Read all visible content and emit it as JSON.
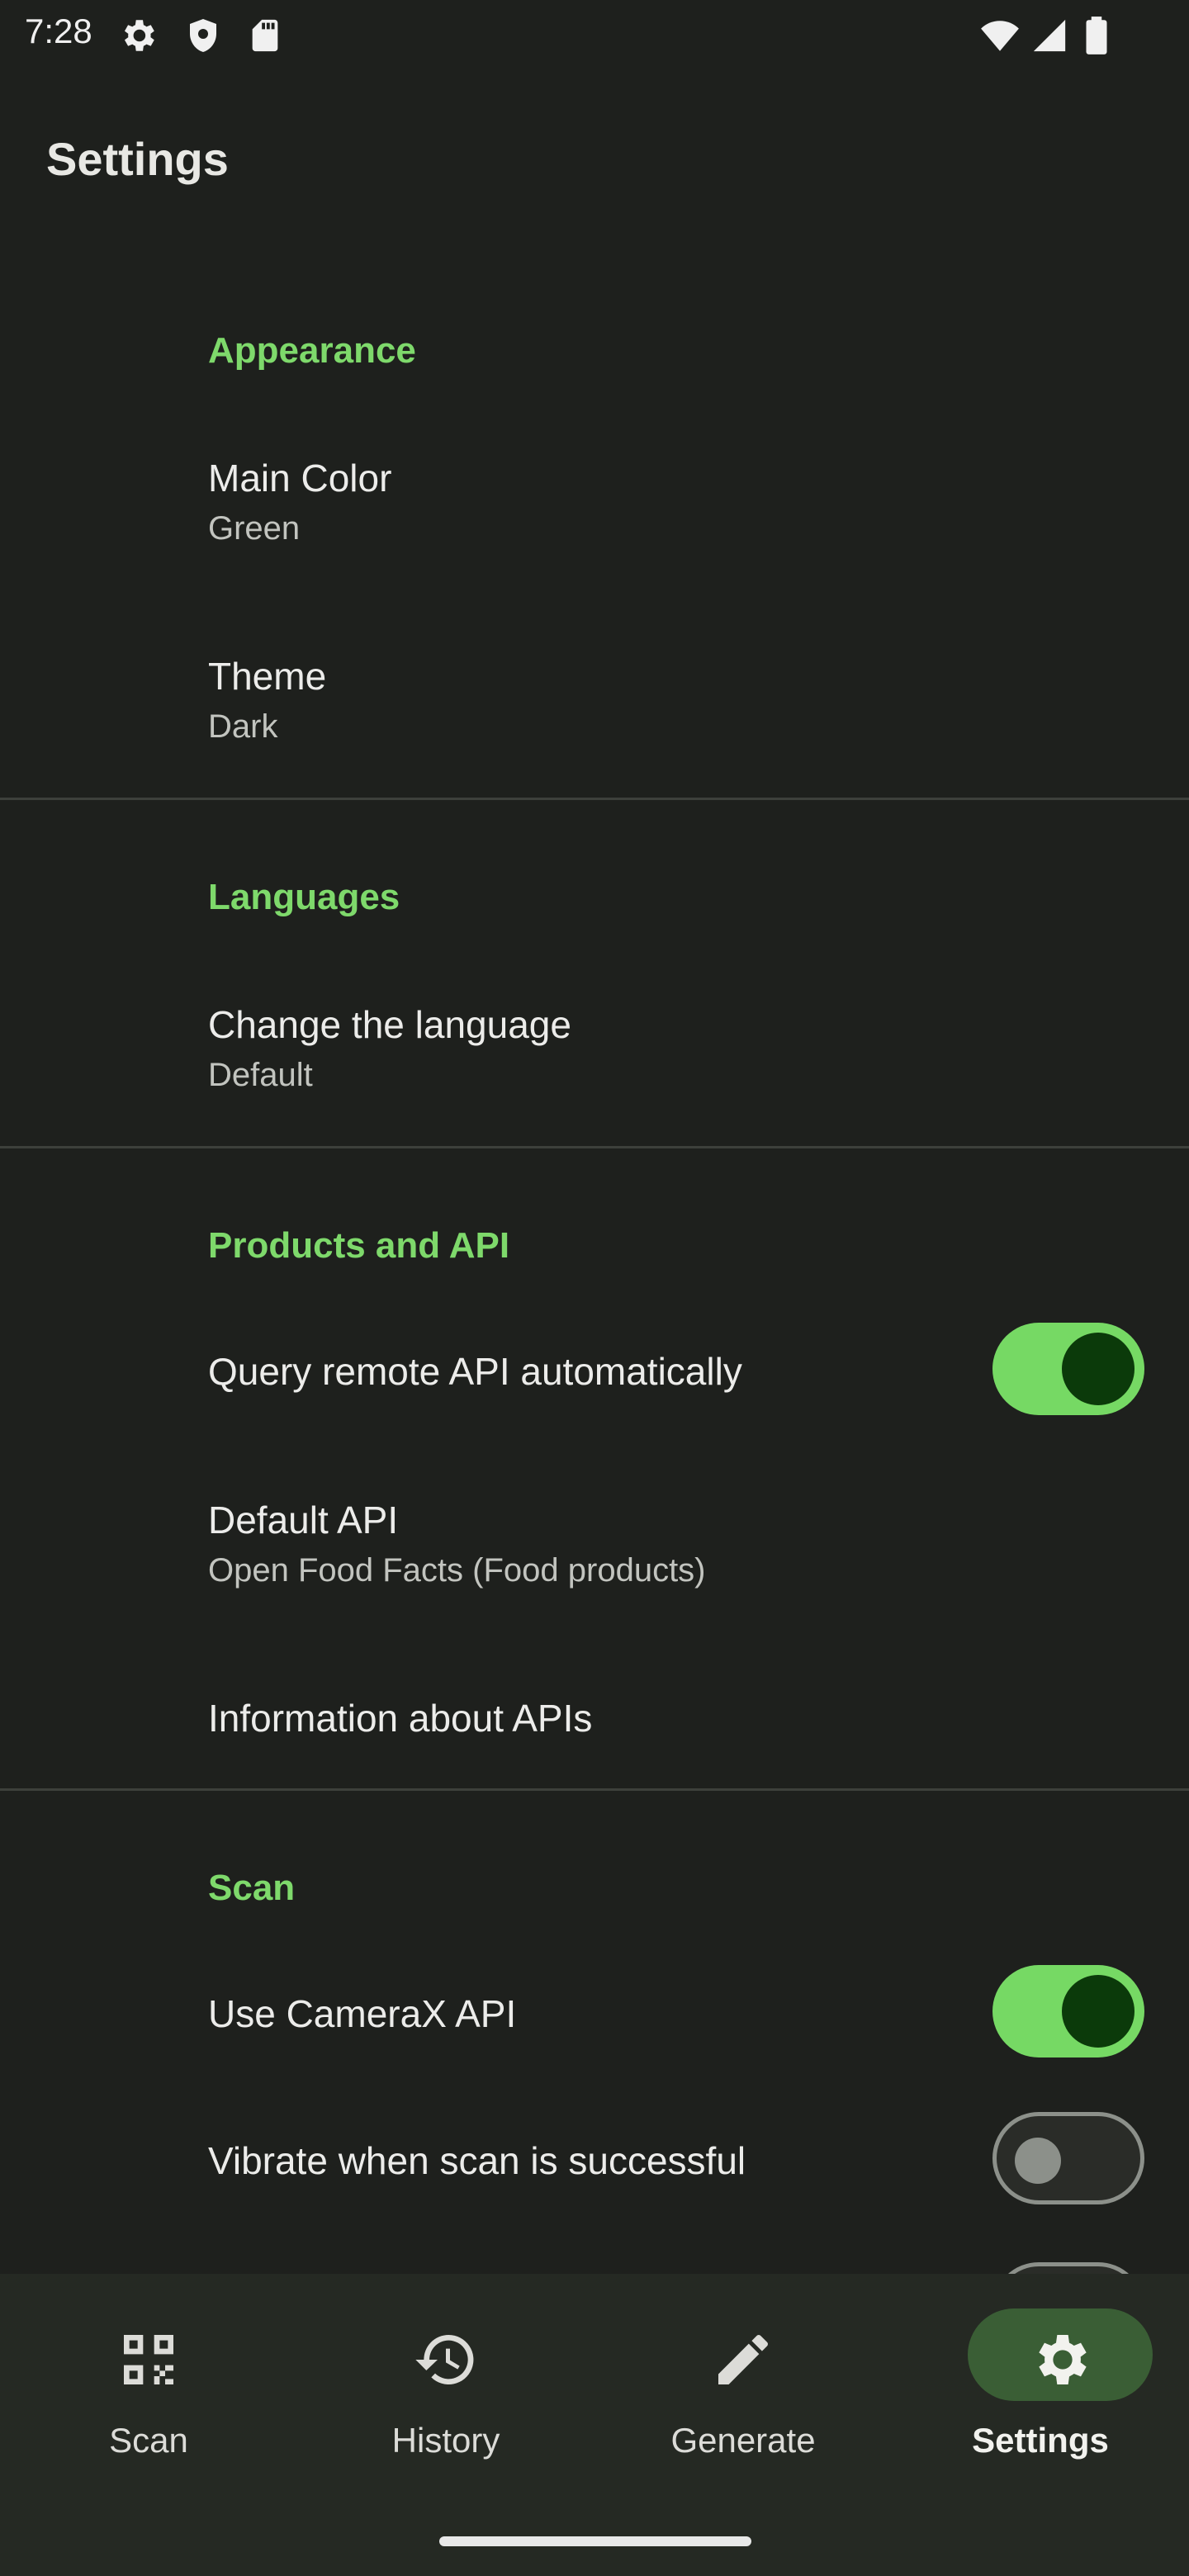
{
  "status_bar": {
    "time": "7:28",
    "icons": [
      "gear-icon",
      "shield-icon",
      "sd-card-icon",
      "wifi-icon",
      "signal-icon",
      "battery-icon"
    ]
  },
  "app_bar": {
    "title": "Settings"
  },
  "colors": {
    "accent": "#7ed96b",
    "background": "#1e201d",
    "switch_on": "#76d964",
    "nav_pill": "#3a5e35"
  },
  "sections": {
    "appearance": {
      "header": "Appearance",
      "main_color": {
        "title": "Main Color",
        "value": "Green"
      },
      "theme": {
        "title": "Theme",
        "value": "Dark"
      }
    },
    "languages": {
      "header": "Languages",
      "change_language": {
        "title": "Change the language",
        "value": "Default"
      }
    },
    "products_api": {
      "header": "Products and API",
      "query_remote": {
        "title": "Query remote API automatically",
        "enabled": true
      },
      "default_api": {
        "title": "Default API",
        "value": "Open Food Facts (Food products)"
      },
      "info_apis": {
        "title": "Information about APIs"
      }
    },
    "scan": {
      "header": "Scan",
      "camerax": {
        "title": "Use CameraX API",
        "enabled": true
      },
      "vibrate": {
        "title": "Vibrate when scan is successful",
        "enabled": false
      }
    }
  },
  "bottom_nav": {
    "items": [
      {
        "label": "Scan",
        "icon": "qr-scan-icon",
        "active": false
      },
      {
        "label": "History",
        "icon": "history-icon",
        "active": false
      },
      {
        "label": "Generate",
        "icon": "pencil-icon",
        "active": false
      },
      {
        "label": "Settings",
        "icon": "gear-icon",
        "active": true
      }
    ]
  }
}
